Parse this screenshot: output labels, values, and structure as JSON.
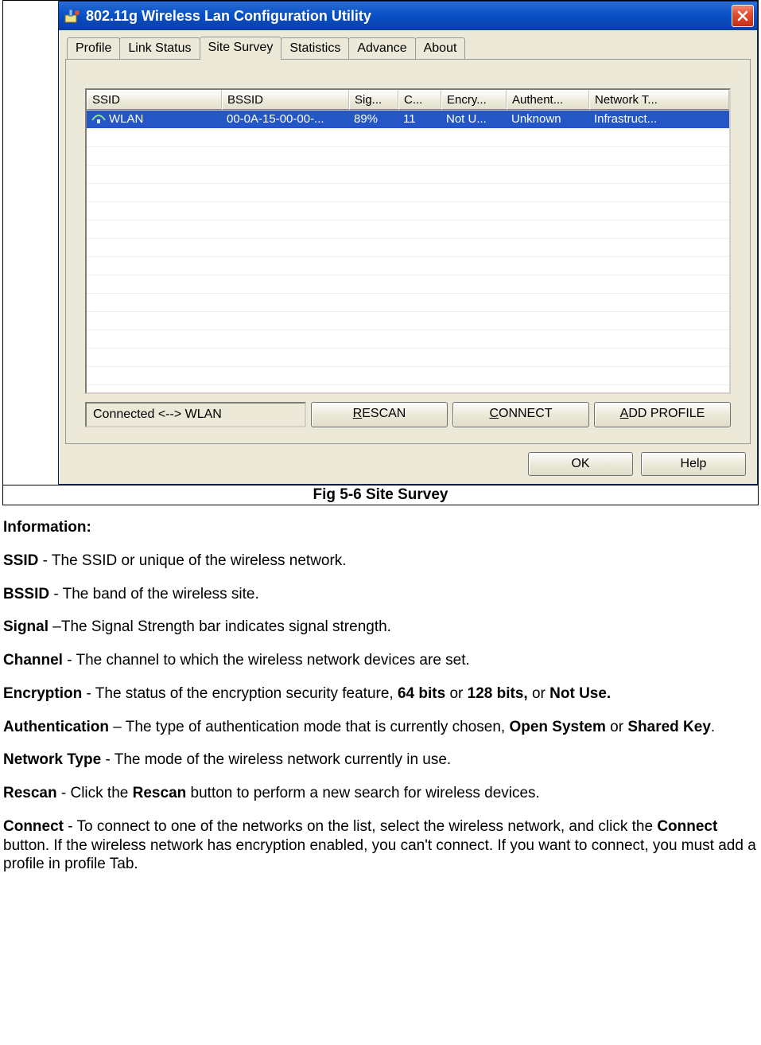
{
  "window": {
    "title": "802.11g Wireless Lan Configuration Utility",
    "tabs": [
      "Profile",
      "Link Status",
      "Site Survey",
      "Statistics",
      "Advance",
      "About"
    ],
    "activeTabIndex": 2,
    "columns": [
      "SSID",
      "BSSID",
      "Sig...",
      "C...",
      "Encry...",
      "Authent...",
      "Network T..."
    ],
    "rows": [
      {
        "ssid": "WLAN",
        "bssid": "00-0A-15-00-00-...",
        "sig": "89%",
        "ch": "11",
        "enc": "Not U...",
        "auth": "Unknown",
        "nt": "Infrastruct..."
      }
    ],
    "emptyRows": 15,
    "status": "Connected <--> WLAN",
    "buttons": {
      "rescan": "RESCAN",
      "connect": "CONNECT",
      "addprofile": "ADD PROFILE"
    },
    "bottom": {
      "ok": "OK",
      "help": "Help"
    }
  },
  "caption": "Fig 5-6 Site Survey",
  "info": {
    "heading": "Information:",
    "items": [
      {
        "term": "SSID",
        "sep": " - ",
        "text": "The SSID or unique of the wireless network."
      },
      {
        "term": "BSSID",
        "sep": " - ",
        "text": "The band of the wireless site."
      },
      {
        "term": "Signal",
        "sep": " –",
        "text": "The Signal Strength bar indicates signal strength."
      },
      {
        "term": "Channel",
        "sep": " - ",
        "text": "The channel to which the wireless network devices are set."
      }
    ],
    "encryption": {
      "term": "Encryption",
      "pre": " - The status of the encryption security feature, ",
      "b1": "64 bits",
      "mid1": " or ",
      "b2": "128 bits,",
      "mid2": " or ",
      "b3": "Not Use."
    },
    "auth": {
      "term": "Authentication",
      "pre": " – The type of authentication mode that is currently chosen, ",
      "b1": "Open System",
      "mid": " or ",
      "b2": "Shared Key",
      "post": "."
    },
    "nettype": {
      "term": "Network Type",
      "sep": " - ",
      "text": "The mode of the wireless network currently in use."
    },
    "rescan": {
      "term": "Rescan",
      "pre": " - Click the ",
      "b1": "Rescan",
      "post": " button to perform a new search for wireless devices."
    },
    "connect": {
      "term": "Connect",
      "pre": " - To connect to one of the networks on the list, select the wireless network, and click the ",
      "b1": "Connect",
      "post": " button. If the wireless network has encryption enabled, you can't connect. If you want to connect, you must add a profile in profile Tab."
    }
  }
}
